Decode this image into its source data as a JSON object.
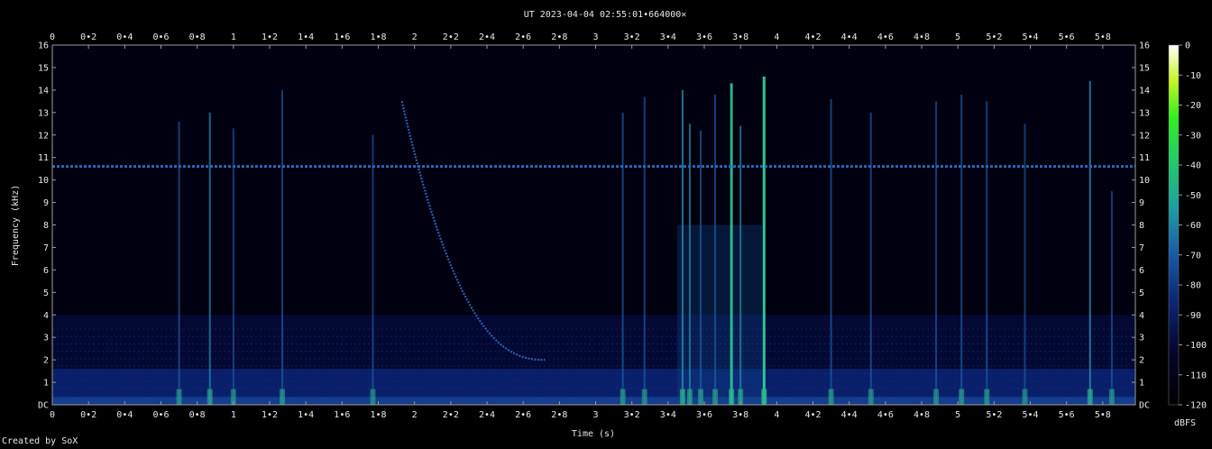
{
  "chart_data": {
    "type": "heatmap",
    "title": "UT 2023-04-04 02:55:01•664000✕",
    "xlabel": "Time (s)",
    "ylabel": "Frequency (kHz)",
    "colorbar_label": "dBFS",
    "xlim": [
      0,
      5.98
    ],
    "ylim": [
      0,
      16
    ],
    "x_ticks": [
      "0",
      "0•2",
      "0•4",
      "0•6",
      "0•8",
      "1",
      "1•2",
      "1•4",
      "1•6",
      "1•8",
      "2",
      "2•2",
      "2•4",
      "2•6",
      "2•8",
      "3",
      "3•2",
      "3•4",
      "3•6",
      "3•8",
      "4",
      "4•2",
      "4•4",
      "4•6",
      "4•8",
      "5",
      "5•2",
      "5•4",
      "5•6",
      "5•8"
    ],
    "y_ticks": [
      "DC",
      "1",
      "2",
      "3",
      "4",
      "5",
      "6",
      "7",
      "8",
      "9",
      "10",
      "11",
      "12",
      "13",
      "14",
      "15",
      "16"
    ],
    "colorbar_ticks": [
      "0",
      "-10",
      "-20",
      "-30",
      "-40",
      "-50",
      "-60",
      "-70",
      "-80",
      "-90",
      "-100",
      "-110",
      "-120"
    ],
    "colorbar_range": [
      -120,
      0
    ],
    "colors": {
      "background": "#000000",
      "low": "#000028",
      "mid": "#1a4ea6",
      "high": "#3cc8a0",
      "peak": "#ffffff"
    },
    "features": {
      "carrier_khz": 10.6,
      "sweep": {
        "start": [
          1.93,
          13.5
        ],
        "end": [
          2.72,
          2.0
        ]
      },
      "impulses": [
        {
          "t": 0.7,
          "top": 12.6,
          "strength": 0.5
        },
        {
          "t": 0.87,
          "top": 13.0,
          "strength": 0.6
        },
        {
          "t": 1.0,
          "top": 12.3,
          "strength": 0.45
        },
        {
          "t": 1.27,
          "top": 14.0,
          "strength": 0.55
        },
        {
          "t": 1.77,
          "top": 12.0,
          "strength": 0.45
        },
        {
          "t": 3.15,
          "top": 13.0,
          "strength": 0.55
        },
        {
          "t": 3.27,
          "top": 13.7,
          "strength": 0.5
        },
        {
          "t": 3.48,
          "top": 14.0,
          "strength": 0.75
        },
        {
          "t": 3.52,
          "top": 12.5,
          "strength": 0.6
        },
        {
          "t": 3.58,
          "top": 12.2,
          "strength": 0.55
        },
        {
          "t": 3.66,
          "top": 13.8,
          "strength": 0.55
        },
        {
          "t": 3.75,
          "top": 14.3,
          "strength": 0.85
        },
        {
          "t": 3.8,
          "top": 12.4,
          "strength": 0.6
        },
        {
          "t": 3.93,
          "top": 14.6,
          "strength": 1.0
        },
        {
          "t": 4.3,
          "top": 13.6,
          "strength": 0.55
        },
        {
          "t": 4.52,
          "top": 13.0,
          "strength": 0.5
        },
        {
          "t": 4.88,
          "top": 13.5,
          "strength": 0.5
        },
        {
          "t": 5.02,
          "top": 13.8,
          "strength": 0.55
        },
        {
          "t": 5.16,
          "top": 13.5,
          "strength": 0.55
        },
        {
          "t": 5.37,
          "top": 12.5,
          "strength": 0.45
        },
        {
          "t": 5.73,
          "top": 14.4,
          "strength": 0.75
        },
        {
          "t": 5.85,
          "top": 9.5,
          "strength": 0.5
        }
      ]
    }
  },
  "footer": {
    "credit": "Created by SoX"
  }
}
